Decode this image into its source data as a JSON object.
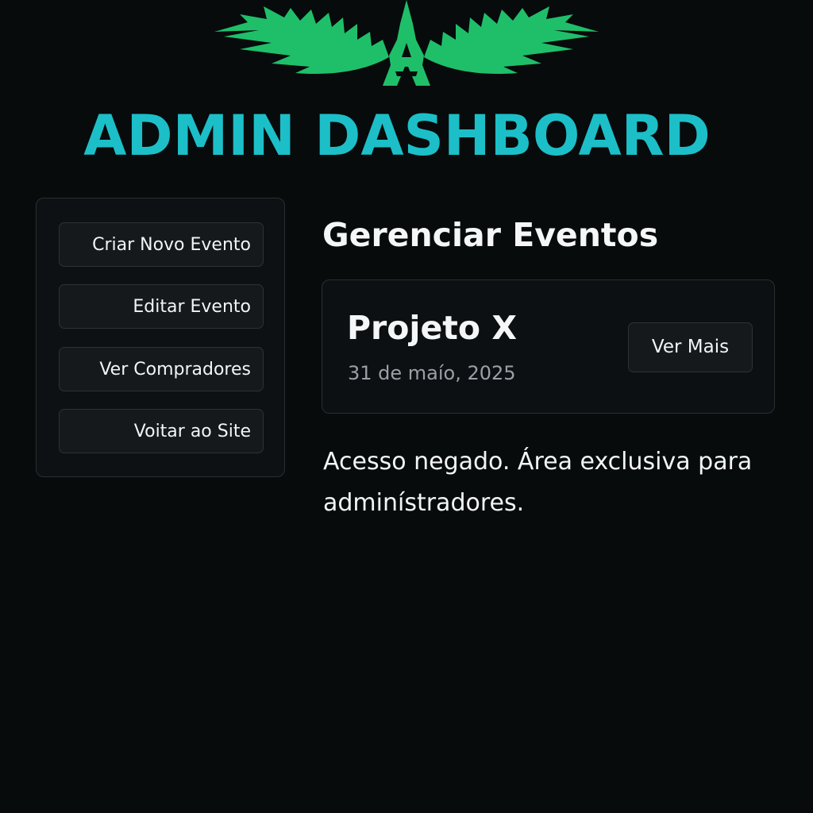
{
  "header": {
    "logo_icon": "green-spiky-wings-tower-logo-icon",
    "logo_color": "#1fbf6a",
    "title": "ADMIN DASHBOARD",
    "title_color": "#1cbfc8"
  },
  "sidebar": {
    "items": [
      {
        "label": "Criar Novo Evento"
      },
      {
        "label": "Editar Evento"
      },
      {
        "label": "Ver Compradores"
      },
      {
        "label": "Voitar ao Site"
      }
    ]
  },
  "main": {
    "section_title": "Gerenciar Eventos",
    "events": [
      {
        "name": "Projeto X",
        "date": "31 de maío, 2025",
        "action_label": "Ver Mais"
      }
    ],
    "access_message": "Acesso negado. Área exclusiva para adminístradores."
  },
  "colors": {
    "background": "#080b0c",
    "panel": "#0e1113",
    "button": "#15191c",
    "border": "#2a2e31",
    "muted_text": "#9aa0a5"
  }
}
